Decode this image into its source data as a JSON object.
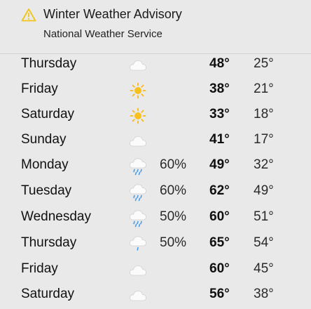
{
  "advisory": {
    "icon": "warning-triangle-icon",
    "title": "Winter Weather Advisory",
    "source": "National Weather Service",
    "accent_color": "#f0c419"
  },
  "forecast": [
    {
      "day": "Thursday",
      "icon": "cloud-icon",
      "precip": "",
      "high": "48°",
      "low": "25°"
    },
    {
      "day": "Friday",
      "icon": "sun-icon",
      "precip": "",
      "high": "38°",
      "low": "21°"
    },
    {
      "day": "Saturday",
      "icon": "sun-icon",
      "precip": "",
      "high": "33°",
      "low": "18°"
    },
    {
      "day": "Sunday",
      "icon": "cloud-icon",
      "precip": "",
      "high": "41°",
      "low": "17°"
    },
    {
      "day": "Monday",
      "icon": "cloud-rain-icon",
      "precip": "60%",
      "high": "49°",
      "low": "32°"
    },
    {
      "day": "Tuesday",
      "icon": "cloud-rain-icon",
      "precip": "60%",
      "high": "62°",
      "low": "49°"
    },
    {
      "day": "Wednesday",
      "icon": "cloud-rain-icon",
      "precip": "50%",
      "high": "60°",
      "low": "51°"
    },
    {
      "day": "Thursday",
      "icon": "cloud-drizzle-icon",
      "precip": "50%",
      "high": "65°",
      "low": "54°"
    },
    {
      "day": "Friday",
      "icon": "cloud-icon",
      "precip": "",
      "high": "60°",
      "low": "45°"
    },
    {
      "day": "Saturday",
      "icon": "cloud-icon",
      "precip": "",
      "high": "56°",
      "low": "38°"
    }
  ]
}
